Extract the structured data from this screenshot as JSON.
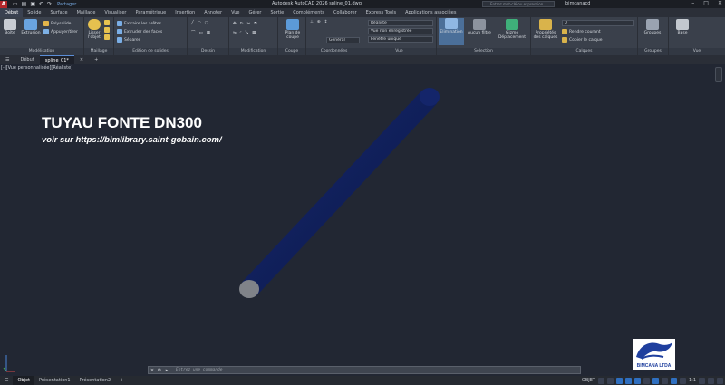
{
  "titlebar": {
    "app_logo": "A",
    "share_label": "Partager",
    "window_title": "Autodesk AutoCAD 2026    spline_01.dwg",
    "search_placeholder": "Entrez mot-clé ou expression",
    "user": "bimcanacd"
  },
  "ribbon_tabs": [
    "Début",
    "Solide",
    "Surface",
    "Maillage",
    "Visualiser",
    "Paramétrique",
    "Insertion",
    "Annoter",
    "Vue",
    "Gérer",
    "Sortie",
    "Compléments",
    "Collaborer",
    "Express Tools",
    "Applications associées"
  ],
  "ribbon": {
    "groups": [
      {
        "title": "Modélisation"
      },
      {
        "title": "Maillage"
      },
      {
        "title": "Edition de solides"
      },
      {
        "title": "Dessin"
      },
      {
        "title": "Modification"
      },
      {
        "title": "Coupe"
      },
      {
        "title": "Coordonnées"
      },
      {
        "title": "Vue"
      },
      {
        "title": "Sélection"
      },
      {
        "title": "Calques"
      },
      {
        "title": "Groupes"
      },
      {
        "title": "Vue"
      }
    ],
    "buttons": {
      "boite": "Boîte",
      "extrusion": "Extrusion",
      "polysolide": "Polysolide",
      "appuyer_tirer": "Appuyer/tirer",
      "lisser_objet": "Lisser l'objet",
      "extraire_aretes": "Extraire les arêtes",
      "extruder_faces": "Extruder des faces",
      "separer": "Séparer",
      "plan_coupe": "Plan de coupe",
      "elimination": "Elimination",
      "aucun_filtre": "Aucun filtre",
      "gizmo": "Gizmo Déplacement",
      "proprietes_calques": "Propriétés des calques",
      "rendre_courant": "Rendre courant",
      "copier_calque": "Copier le calque",
      "groupes": "Groupes",
      "base": "Base"
    },
    "combos": {
      "visual_style": "Réaliste",
      "view": "Vue non enregistrée",
      "viewport": "Fenêtre unique",
      "coord": "Général",
      "layer": "0"
    }
  },
  "doc_tabs": [
    "Début",
    "spline_01*"
  ],
  "viewport": {
    "label": "[-][Vue personnalisée][Réaliste]",
    "title": "TUYAU FONTE DN300",
    "subtitle": "voir sur https://bimlibrary.saint-gobain.com/",
    "pipe_color": "#0f1f5c"
  },
  "command": {
    "placeholder": "Entrez une commande"
  },
  "status": {
    "tabs": [
      "Objet",
      "Présentation1",
      "Présentation2"
    ],
    "mode": "OBJET",
    "scale": "1:1"
  },
  "logo": {
    "text": "BIMCANA LTDA"
  }
}
